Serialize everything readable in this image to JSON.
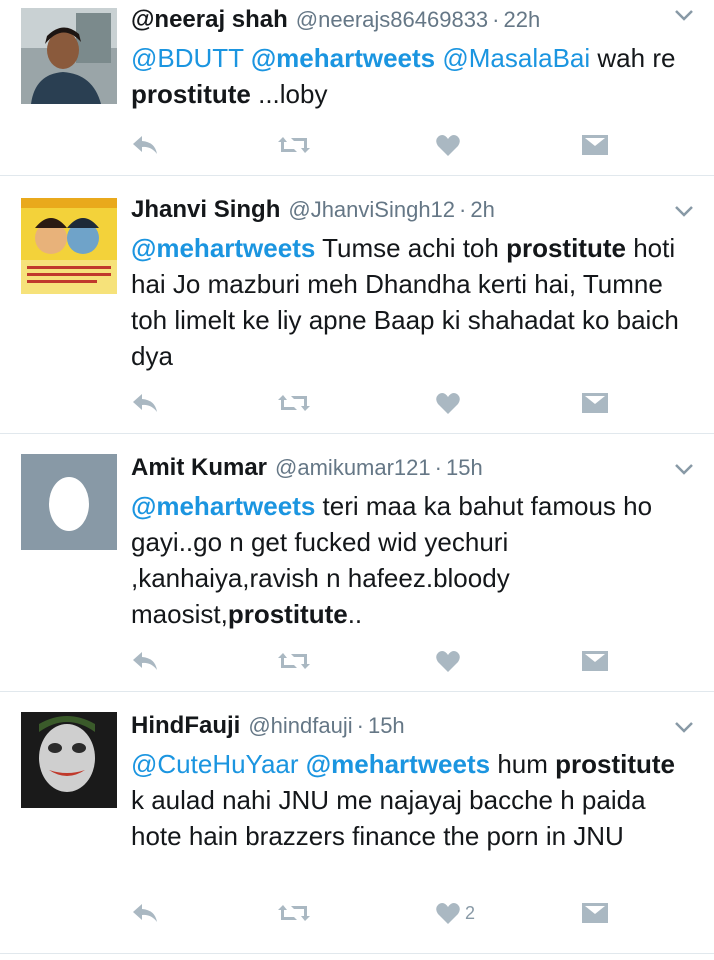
{
  "colors": {
    "link": "#1b95e0",
    "icon": "#aab8c2",
    "muted": "#657786",
    "divider": "#e1e8ed"
  },
  "tweets": [
    {
      "name": "",
      "handle": "@neeraj shah",
      "handle2": "@neerajs86469833",
      "time": "22h",
      "avatar_icon": "user-photo",
      "segments": [
        {
          "t": "@BDUTT",
          "cls": "mention"
        },
        {
          "t": " ",
          "cls": ""
        },
        {
          "t": "@mehartweets",
          "cls": "mention b"
        },
        {
          "t": " ",
          "cls": ""
        },
        {
          "t": "@MasalaBai",
          "cls": "mention"
        },
        {
          "t": " wah re ",
          "cls": ""
        },
        {
          "t": "prostitute",
          "cls": "kw"
        },
        {
          "t": " ...loby",
          "cls": ""
        }
      ],
      "likes": ""
    },
    {
      "name": "Jhanvi Singh",
      "handle": "@JhanviSingh12",
      "time": "2h",
      "avatar_icon": "devotional-image",
      "segments": [
        {
          "t": "@mehartweets",
          "cls": "mention b"
        },
        {
          "t": " Tumse achi toh ",
          "cls": ""
        },
        {
          "t": "prostitute",
          "cls": "kw"
        },
        {
          "t": " hoti hai Jo mazburi meh Dhandha kerti hai, Tumne toh limelt ke liy apne Baap ki shahadat ko baich dya",
          "cls": ""
        }
      ],
      "likes": ""
    },
    {
      "name": "Amit Kumar",
      "handle": "@amikumar121",
      "time": "15h",
      "avatar_icon": "default-egg-avatar",
      "segments": [
        {
          "t": "@mehartweets",
          "cls": "mention b"
        },
        {
          "t": " teri maa ka bahut famous ho gayi..go n get fucked wid yechuri ,kanhaiya,ravish n hafeez.bloody maosist,",
          "cls": ""
        },
        {
          "t": "prostitute",
          "cls": "kw"
        },
        {
          "t": "..",
          "cls": ""
        }
      ],
      "likes": ""
    },
    {
      "name": "HindFauji",
      "handle": "@hindfauji",
      "time": "15h",
      "avatar_icon": "joker-image",
      "segments": [
        {
          "t": "@CuteHuYaar",
          "cls": "mention"
        },
        {
          "t": " ",
          "cls": ""
        },
        {
          "t": "@mehartweets",
          "cls": "mention b"
        },
        {
          "t": " hum ",
          "cls": ""
        },
        {
          "t": "prostitute",
          "cls": "kw"
        },
        {
          "t": " k aulad nahi JNU me najayaj bacche h paida hote hain brazzers finance the porn in JNU",
          "cls": ""
        }
      ],
      "likes": "2"
    }
  ]
}
